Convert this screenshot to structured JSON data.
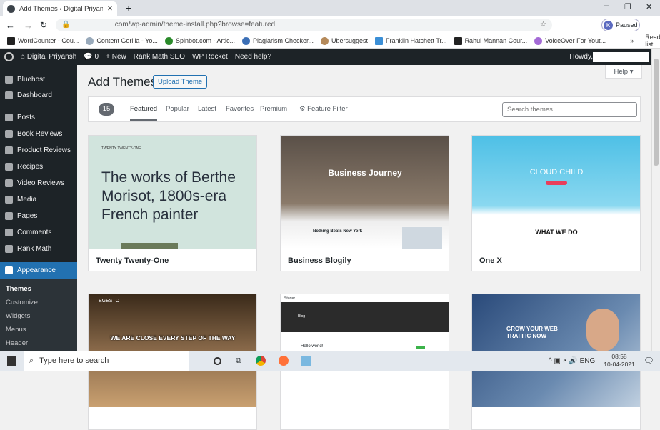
{
  "browser": {
    "tab_title": "Add Themes ‹ Digital Priyansh —",
    "url": ".com/wp-admin/theme-install.php?browse=featured",
    "profile": "Paused",
    "profile_initial": "K",
    "bookmarks": [
      "WordCounter - Cou...",
      "Content Gorilla - Yo...",
      "Spinbot.com - Artic...",
      "Plagiarism Checker...",
      "Ubersuggest",
      "Franklin Hatchett Tr...",
      "Rahul Mannan Cour...",
      "VoiceOver For Yout..."
    ],
    "more": "»",
    "reading_list": "Reading list"
  },
  "adminbar": {
    "site": "Digital Priyansh",
    "comments": "0",
    "new": "+ New",
    "rankmath": "Rank Math SEO",
    "rocket": "WP Rocket",
    "help": "Need help?",
    "howdy": "Howdy,"
  },
  "sidebar": {
    "items": [
      "Bluehost",
      "Dashboard",
      "Posts",
      "Book Reviews",
      "Product Reviews",
      "Recipes",
      "Video Reviews",
      "Media",
      "Pages",
      "Comments",
      "Rank Math",
      "Appearance"
    ],
    "sub": [
      "Themes",
      "Customize",
      "Widgets",
      "Menus",
      "Header"
    ]
  },
  "page": {
    "title": "Add Themes",
    "upload": "Upload Theme",
    "help": "Help ▾",
    "count": "15",
    "tabs": [
      "Featured",
      "Popular",
      "Latest",
      "Favorites",
      "Premium"
    ],
    "feature_filter": "Feature Filter",
    "search_placeholder": "Search themes..."
  },
  "themes": [
    {
      "name": "Twenty Twenty-One",
      "thumb_header": "TWENTY TWENTY-ONE",
      "thumb_text": "The works of Berthe Morisot, 1800s-era French painter"
    },
    {
      "name": "Business Blogily",
      "thumb_text": "Business Journey",
      "thumb_sub": "Nothing Beats New York"
    },
    {
      "name": "One X",
      "thumb_text": "CLOUD CHILD",
      "thumb_sub": "WHAT WE DO"
    },
    {
      "name": "",
      "thumb_text": "EGESTO",
      "thumb_sub": "WE ARE CLOSE EVERY STEP OF THE WAY"
    },
    {
      "name": "",
      "thumb_text": "Starter",
      "thumb_sub": "Blog",
      "thumb_sub2": "Hello world!"
    },
    {
      "name": "",
      "thumb_text": "GROW YOUR WEB TRAFFIC NOW"
    }
  ],
  "taskbar": {
    "search": "Type here to search",
    "lang": "ENG",
    "time": "08:58",
    "date": "10-04-2021"
  },
  "colors": {
    "accent": "#2271b1",
    "adminbar": "#1d2327"
  }
}
